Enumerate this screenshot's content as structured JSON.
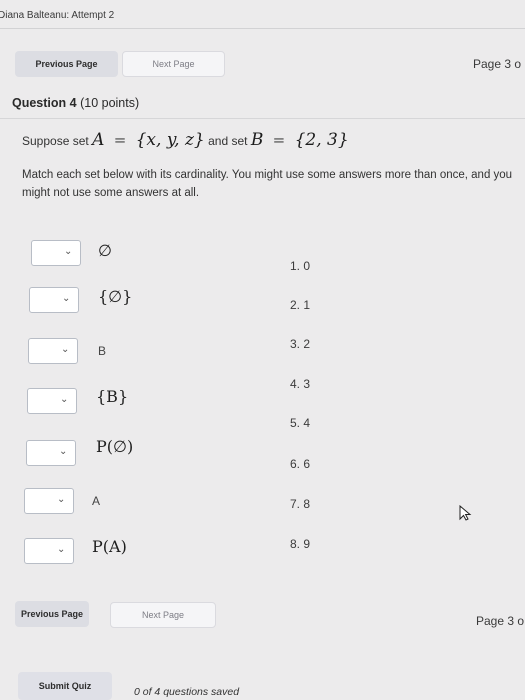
{
  "header": {
    "title": "Diana Balteanu: Attempt 2"
  },
  "top_nav": {
    "previous": "Previous Page",
    "next": "Next Page",
    "page": "Page 3 o"
  },
  "question": {
    "number": "Question 4",
    "points": "(10 points)",
    "prompt_prefix": "Suppose set",
    "set_a_name": "A",
    "set_a_value": "{x, y, z}",
    "connector": "and set",
    "set_b_name": "B",
    "set_b_value": "{2, 3}",
    "equals": "=",
    "instruction": "Match each set below with its cardinality. You might use some answers more than once, and you might not use some answers at all."
  },
  "items": [
    {
      "label": "∅",
      "dropdown_value": ""
    },
    {
      "label": "{∅}",
      "dropdown_value": ""
    },
    {
      "label": "B",
      "dropdown_value": ""
    },
    {
      "label": "{B}",
      "dropdown_value": ""
    },
    {
      "label": "P(∅)",
      "dropdown_value": ""
    },
    {
      "label": "A",
      "dropdown_value": ""
    },
    {
      "label": "P(A)",
      "dropdown_value": ""
    }
  ],
  "dropdown_icon": "chevron-down-icon",
  "answers": [
    "1. 0",
    "2. 1",
    "3. 2",
    "4. 3",
    "5. 4",
    "6. 6",
    "7. 8",
    "8. 9"
  ],
  "bottom_nav": {
    "previous": "Previous Page",
    "next": "Next Page",
    "page": "Page 3 o"
  },
  "footer": {
    "submit": "Submit Quiz",
    "status": "0 of 4 questions saved"
  }
}
